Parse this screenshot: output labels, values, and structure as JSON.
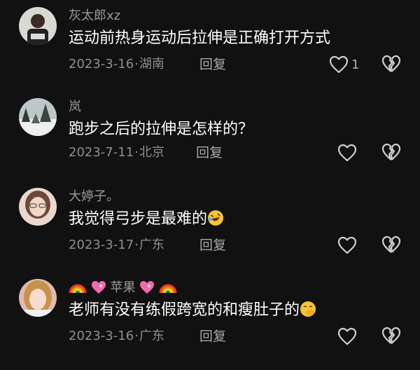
{
  "comments": [
    {
      "username": "灰太郎xz",
      "text": "运动前热身运动后拉伸是正确打开方式",
      "date": "2023-3-16",
      "location": "湖南",
      "reply_label": "回复",
      "like_count": "1"
    },
    {
      "username": "岚",
      "text": "跑步之后的拉伸是怎样的？",
      "date": "2023-7-11",
      "location": "北京",
      "reply_label": "回复",
      "like_count": ""
    },
    {
      "username": "大婷子。",
      "text": "我觉得弓步是最难的",
      "date": "2023-3-17",
      "location": "广东",
      "reply_label": "回复",
      "like_count": ""
    },
    {
      "username": "苹果",
      "text": "老师有没有练假跨宽的和瘦肚子的",
      "date": "2023-3-16",
      "location": "广东",
      "reply_label": "回复",
      "like_count": ""
    }
  ],
  "icons": {
    "like": "heart-outline-icon",
    "dislike": "broken-heart-icon",
    "emoji_laugh": "rolling-laughing-emoji",
    "emoji_shush": "hand-over-mouth-emoji",
    "rainbow": "rainbow-emoji",
    "sparkle_heart": "sparkling-heart-emoji"
  },
  "colors": {
    "background": "#111111",
    "username": "#9a9a9a",
    "meta": "#8e8e8e"
  }
}
